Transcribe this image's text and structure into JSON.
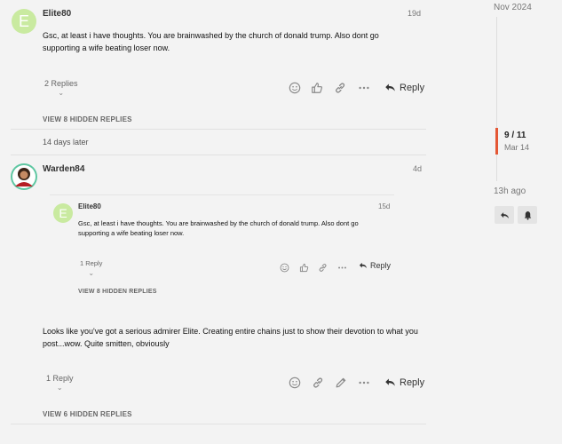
{
  "posts": [
    {
      "username": "Elite80",
      "avatar_letter": "E",
      "date": "19d",
      "body": "Gsc, at least i have thoughts. You are brainwashed by the church of donald trump. Also dont go supporting a wife beating loser now.",
      "replies_label": "2 Replies",
      "reply_label": "Reply",
      "hidden_replies": "VIEW 8 HIDDEN REPLIES"
    },
    {
      "gap_label": "14 days later",
      "username": "Warden84",
      "date": "4d",
      "quote": {
        "username": "Elite80",
        "avatar_letter": "E",
        "date": "15d",
        "body": "Gsc, at least i have thoughts. You are brainwashed by the church of donald trump. Also dont go supporting a wife beating loser now.",
        "replies_label": "1 Reply",
        "reply_label": "Reply",
        "hidden_replies": "VIEW 8 HIDDEN REPLIES"
      },
      "body": "Looks like you've got a serious admirer Elite. Creating entire chains just to show their devotion to what you post...wow. Quite smitten, obviously",
      "replies_label": "1 Reply",
      "reply_label": "Reply",
      "hidden_replies": "VIEW 6 HIDDEN REPLIES"
    }
  ],
  "timeline": {
    "top_date": "Nov 2024",
    "position": "9 / 11",
    "position_date": "Mar 14",
    "bottom_date": "13h ago",
    "accent_color": "#e45735"
  }
}
